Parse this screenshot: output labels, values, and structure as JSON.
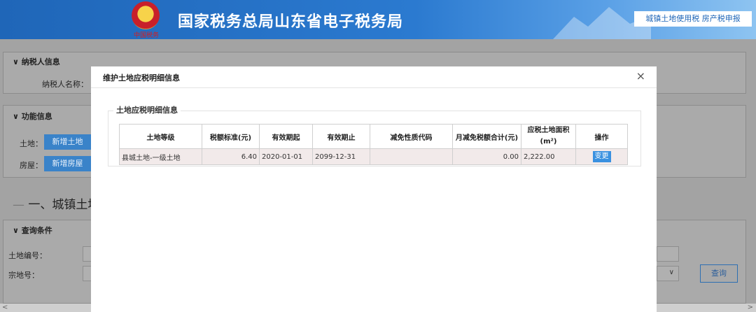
{
  "header": {
    "emblem_text": "中国税务",
    "title": "国家税务总局山东省电子税务局",
    "chip": "城镇土地使用税 房产税申报"
  },
  "background": {
    "taxpayer_section": "纳税人信息",
    "taxpayer_name_label": "纳税人名称：",
    "function_section": "功能信息",
    "land_label": "土地：",
    "add_land_button": "新增土地",
    "house_label": "房屋：",
    "add_house_button": "新增房屋",
    "big_heading": "一、城镇土地使",
    "query_section": "查询条件",
    "land_no_label": "土地编号：",
    "parcel_no_label": "宗地号：",
    "query_button": "查询"
  },
  "modal": {
    "title": "维护土地应税明细信息",
    "close": "×",
    "legend": "土地应税明细信息",
    "columns": [
      "土地等级",
      "税额标准(元)",
      "有效期起",
      "有效期止",
      "减免性质代码",
      "月减免税额合计(元)",
      "应税土地面积\n(m²)",
      "操作"
    ],
    "rows": [
      {
        "grade": "县城土地-一级土地",
        "standard": "6.40",
        "start": "2020-01-01",
        "end": "2099-12-31",
        "code": "",
        "monthly_relief": "0.00",
        "area": "2,222.00",
        "action": "变更"
      }
    ]
  },
  "colors": {
    "header_blue": "#1f66b8",
    "button_blue": "#3a91e0"
  }
}
